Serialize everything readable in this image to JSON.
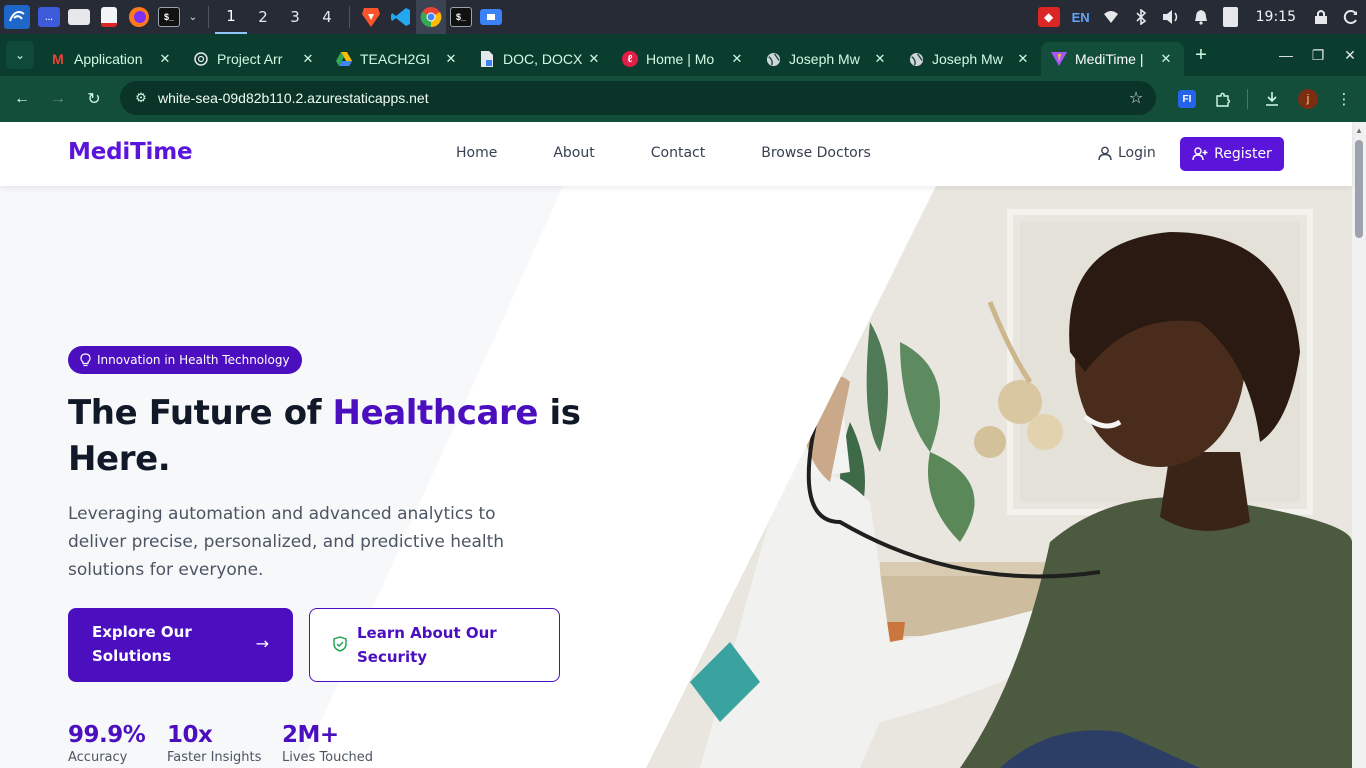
{
  "taskbar": {
    "workspaces": [
      "1",
      "2",
      "3",
      "4"
    ],
    "active_workspace": "1",
    "language": "EN",
    "clock": "19:15",
    "icons": [
      "kali-menu-icon",
      "desktop-icon",
      "file-manager-icon",
      "text-editor-icon",
      "firefox-icon",
      "terminal-icon",
      "brave-icon",
      "vscode-icon",
      "chrome-icon",
      "terminal-icon",
      "files-icon"
    ]
  },
  "browser": {
    "tabs": [
      {
        "title": "Application",
        "favicon": "gmail-icon",
        "color": "#ea4335"
      },
      {
        "title": "Project Arr",
        "favicon": "chatgpt-icon",
        "color": "#e5e7eb"
      },
      {
        "title": "TEACH2GI",
        "favicon": "google-drive-icon",
        "color": "#fbbc04"
      },
      {
        "title": "DOC, DOCX",
        "favicon": "document-icon",
        "color": "#e5e7eb"
      },
      {
        "title": "Home | Mo",
        "favicon": "site-icon",
        "color": "#e11d48"
      },
      {
        "title": "Joseph Mw",
        "favicon": "globe-icon",
        "color": "#e5e7eb"
      },
      {
        "title": "Joseph Mw",
        "favicon": "globe-icon",
        "color": "#e5e7eb"
      },
      {
        "title": "MediTime |",
        "favicon": "vite-icon",
        "color": "#a855f7",
        "active": true
      }
    ],
    "url": "white-sea-09d82b110.2.azurestaticapps.net",
    "profile_initial": "j",
    "extension_label": "FI"
  },
  "site": {
    "brand": "MediTime",
    "nav": [
      "Home",
      "About",
      "Contact",
      "Browse Doctors"
    ],
    "login_label": "Login",
    "register_label": "Register",
    "brand_color": "#5b14d9"
  },
  "hero": {
    "badge": "Innovation in Health Technology",
    "headline_part1": "The Future of ",
    "headline_accent": "Healthcare",
    "headline_part2": " is Here.",
    "description": "Leveraging automation and advanced analytics to deliver precise, personalized, and predictive health solutions for everyone.",
    "primary_cta": "Explore Our Solutions",
    "secondary_cta": "Learn About Our Security",
    "stats": [
      {
        "value": "99.9%",
        "label": "Accuracy"
      },
      {
        "value": "10x",
        "label": "Faster Insights"
      },
      {
        "value": "2M+",
        "label": "Lives Touched"
      }
    ]
  }
}
